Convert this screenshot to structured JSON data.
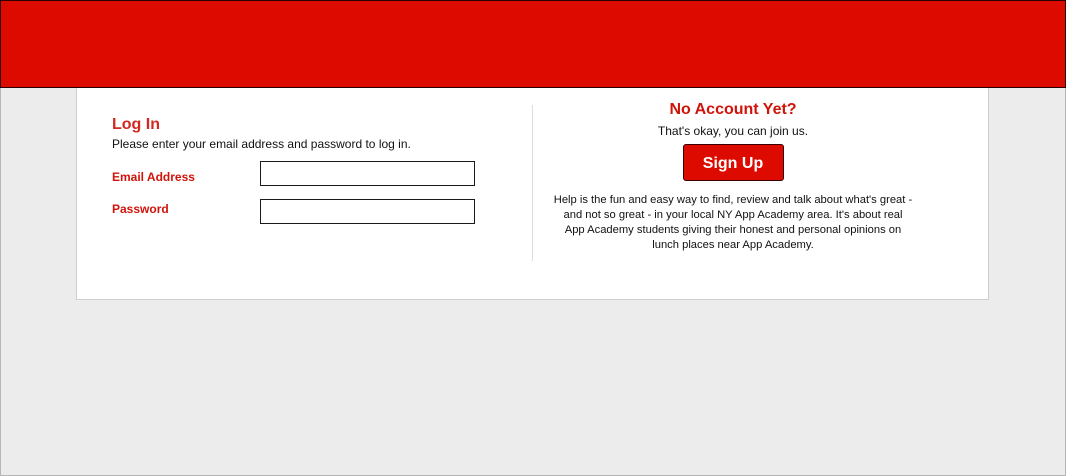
{
  "header": {
    "color": "#dd0a00"
  },
  "login": {
    "title": "Log In",
    "description": "Please enter your email address and password to log in.",
    "email_label": "Email Address",
    "email_value": "",
    "password_label": "Password",
    "password_value": ""
  },
  "signup": {
    "title": "No Account Yet?",
    "subtitle": "That's okay, you can join us.",
    "button_label": "Sign Up",
    "blurb": "Help is the fun and easy way to find, review and talk about what's great - and not so great - in your local NY App Academy area. It's about real App Academy students giving their honest and personal opinions on lunch places near App Academy."
  },
  "colors": {
    "accent": "#d0140a",
    "page_background": "#ececec",
    "panel_background": "#ffffff"
  }
}
